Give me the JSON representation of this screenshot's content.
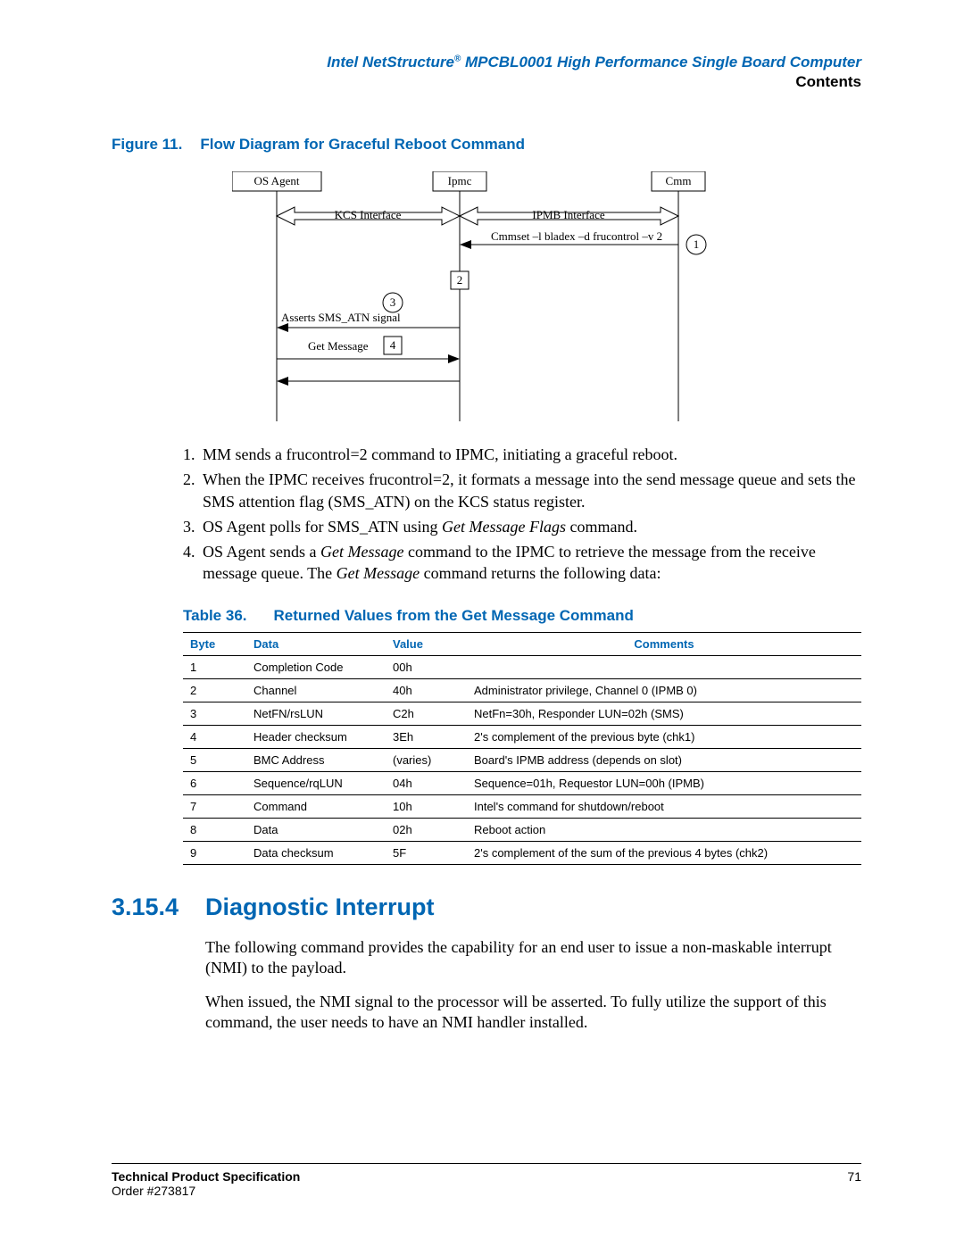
{
  "header": {
    "product_line_prefix": "Intel NetStructure",
    "product_line_suffix": " MPCBL0001 High Performance Single Board Computer",
    "section": "Contents"
  },
  "figure": {
    "label": "Figure 11.",
    "title": "Flow Diagram for Graceful Reboot Command"
  },
  "diagram": {
    "boxes": {
      "os_agent": "OS Agent",
      "ipmc": "Ipmc",
      "cmm": "Cmm"
    },
    "kcs": "KCS Interface",
    "ipmb": "IPMB Interface",
    "cmmset": "Cmmset –l bladex –d frucontrol –v 2",
    "asserts": "Asserts SMS_ATN signal",
    "getmsg": "Get Message",
    "n1": "1",
    "n2": "2",
    "n3": "3",
    "n4": "4"
  },
  "list": {
    "i1": "MM sends a frucontrol=2 command to IPMC, initiating a graceful reboot.",
    "i2": "When the IPMC receives frucontrol=2, it formats a message into the send message queue and sets the SMS attention flag (SMS_ATN) on the KCS status register.",
    "i3_pre": "OS Agent polls for SMS_ATN using ",
    "i3_em": "Get Message Flags",
    "i3_post": " command.",
    "i4_pre": "OS Agent sends a ",
    "i4_em1": "Get Message",
    "i4_mid": " command to the IPMC to retrieve the message from the receive message queue. The ",
    "i4_em2": "Get Message",
    "i4_post": " command returns the following data:"
  },
  "table": {
    "label": "Table 36.",
    "title": "Returned Values from the Get Message Command",
    "headers": {
      "byte": "Byte",
      "data": "Data",
      "value": "Value",
      "comments": "Comments"
    },
    "rows": [
      {
        "byte": "1",
        "data": "Completion Code",
        "value": "00h",
        "comments": ""
      },
      {
        "byte": "2",
        "data": "Channel",
        "value": "40h",
        "comments": "Administrator privilege, Channel 0 (IPMB 0)"
      },
      {
        "byte": "3",
        "data": "NetFN/rsLUN",
        "value": "C2h",
        "comments": "NetFn=30h, Responder LUN=02h (SMS)"
      },
      {
        "byte": "4",
        "data": "Header checksum",
        "value": "3Eh",
        "comments": "2's complement of the previous byte (chk1)"
      },
      {
        "byte": "5",
        "data": "BMC Address",
        "value": "(varies)",
        "comments": "Board's IPMB address (depends on slot)"
      },
      {
        "byte": "6",
        "data": "Sequence/rqLUN",
        "value": "04h",
        "comments": "Sequence=01h, Requestor LUN=00h (IPMB)"
      },
      {
        "byte": "7",
        "data": "Command",
        "value": "10h",
        "comments": "Intel's command for shutdown/reboot"
      },
      {
        "byte": "8",
        "data": "Data",
        "value": "02h",
        "comments": "Reboot action"
      },
      {
        "byte": "9",
        "data": "Data checksum",
        "value": "5F",
        "comments": "2's complement of the sum of the previous 4 bytes (chk2)"
      }
    ]
  },
  "section": {
    "number": "3.15.4",
    "title": "Diagnostic Interrupt"
  },
  "paragraphs": {
    "p1": "The following command provides the capability for an end user to issue a non-maskable interrupt (NMI) to the payload.",
    "p2": "When issued, the NMI signal to the processor will be asserted. To fully utilize the support of this command, the user needs to have an NMI handler installed."
  },
  "footer": {
    "tps": "Technical Product Specification",
    "order": "Order #273817",
    "page": "71"
  }
}
